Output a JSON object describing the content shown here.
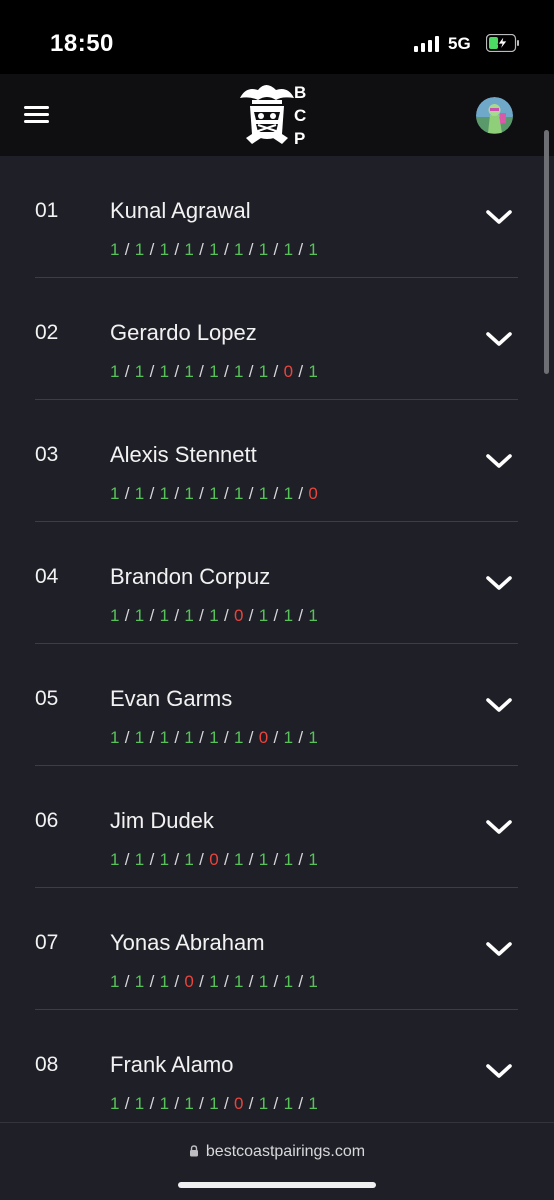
{
  "status_bar": {
    "time": "18:50",
    "network": "5G",
    "icons": [
      "signal-icon",
      "battery-charging-icon"
    ]
  },
  "header": {
    "menu_icon": "hamburger-menu-icon",
    "logo_icon": "bcp-pirate-logo-icon",
    "logo_letters": [
      "B",
      "C",
      "P"
    ],
    "avatar_icon": "user-avatar-icon"
  },
  "colors": {
    "win": "#58c25a",
    "loss": "#e8453c",
    "background": "#1f1f27",
    "header_bg": "#0f0f12"
  },
  "players": [
    {
      "rank": "01",
      "name": "Kunal Agrawal",
      "results": [
        "1",
        "1",
        "1",
        "1",
        "1",
        "1",
        "1",
        "1",
        "1"
      ]
    },
    {
      "rank": "02",
      "name": "Gerardo Lopez",
      "results": [
        "1",
        "1",
        "1",
        "1",
        "1",
        "1",
        "1",
        "0",
        "1"
      ]
    },
    {
      "rank": "03",
      "name": "Alexis Stennett",
      "results": [
        "1",
        "1",
        "1",
        "1",
        "1",
        "1",
        "1",
        "1",
        "0"
      ]
    },
    {
      "rank": "04",
      "name": "Brandon Corpuz",
      "results": [
        "1",
        "1",
        "1",
        "1",
        "1",
        "0",
        "1",
        "1",
        "1"
      ]
    },
    {
      "rank": "05",
      "name": "Evan Garms",
      "results": [
        "1",
        "1",
        "1",
        "1",
        "1",
        "1",
        "0",
        "1",
        "1"
      ]
    },
    {
      "rank": "06",
      "name": "Jim Dudek",
      "results": [
        "1",
        "1",
        "1",
        "1",
        "0",
        "1",
        "1",
        "1",
        "1"
      ]
    },
    {
      "rank": "07",
      "name": "Yonas Abraham",
      "results": [
        "1",
        "1",
        "1",
        "0",
        "1",
        "1",
        "1",
        "1",
        "1"
      ]
    },
    {
      "rank": "08",
      "name": "Frank Alamo",
      "results": [
        "1",
        "1",
        "1",
        "1",
        "1",
        "0",
        "1",
        "1",
        "1"
      ]
    }
  ],
  "row_icon": "chevron-down-icon",
  "url_bar": {
    "lock_icon": "lock-icon",
    "url": "bestcoastpairings.com"
  }
}
